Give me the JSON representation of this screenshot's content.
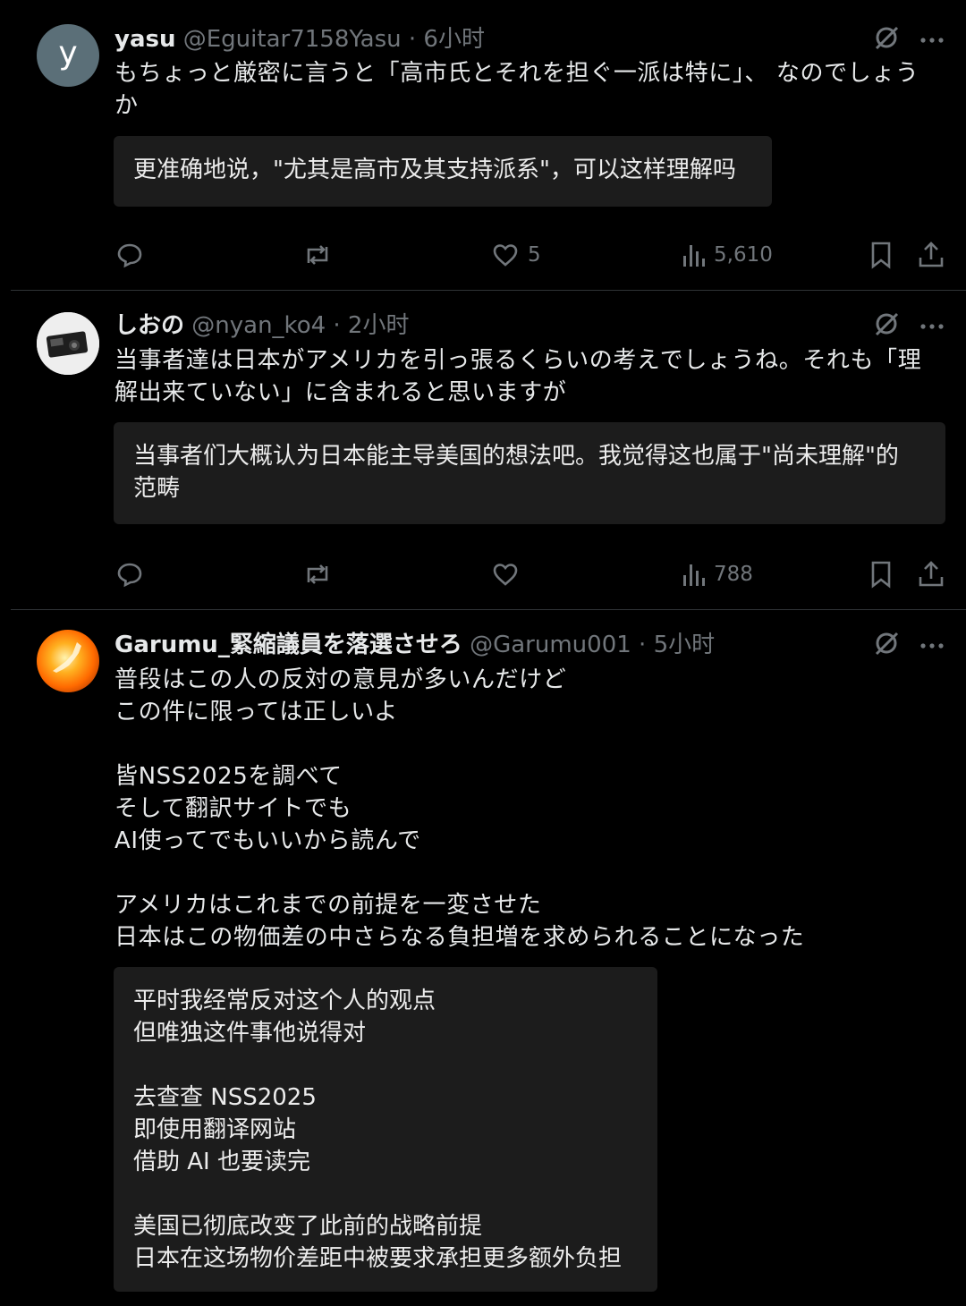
{
  "tweets": [
    {
      "name": "yasu",
      "handle": "@Eguitar7158Yasu",
      "time": "· 6小时",
      "avatar_letter": "y",
      "text": "もちょっと厳密に言うと「高市氏とそれを担ぐ一派は特に」、 なのでしょう\nか",
      "translation": "更准确地说，\"尤其是高市及其支持派系\"，可以这样理解吗",
      "likes": "5",
      "views": "5,610"
    },
    {
      "name": "しおの",
      "handle": "@nyan_ko4",
      "time": "· 2小时",
      "text": "当事者達は日本がアメリカを引っ張るくらいの考えでしょうね。それも「理\n解出来ていない」に含まれると思いますが",
      "translation": "当事者们大概认为日本能主导美国的想法吧。我觉得这也属于\"尚未理解\"的\n范畴",
      "likes": "",
      "views": "788"
    },
    {
      "name": "Garumu_緊縮議員を落選させろ",
      "handle": "@Garumu001",
      "time": "· 5小时",
      "text": "普段はこの人の反対の意見が多いんだけど\nこの件に限っては正しいよ\n\n皆NSS2025を調べて\nそして翻訳サイトでも\nAI使ってでもいいから読んで\n\nアメリカはこれまでの前提を一変させた\n日本はこの物価差の中さらなる負担増を求められることになった",
      "translation": "平时我经常反对这个人的观点\n但唯独这件事他说得对\n\n去查查 NSS2025\n即使用翻译网站\n借助 AI 也要读完\n\n美国已彻底改变了此前的战略前提\n日本在这场物价差距中被要求承担更多额外负担"
    }
  ],
  "icons": {
    "header": [
      "grok-icon",
      "more-icon"
    ],
    "actions": [
      "reply-icon",
      "retweet-icon",
      "like-icon",
      "views-icon",
      "bookmark-icon",
      "share-icon"
    ]
  },
  "colors": {
    "background": "#000000",
    "text": "#e7e9ea",
    "muted": "#71767b",
    "translation_box": "#1c1c1c",
    "divider": "#2f3336"
  }
}
